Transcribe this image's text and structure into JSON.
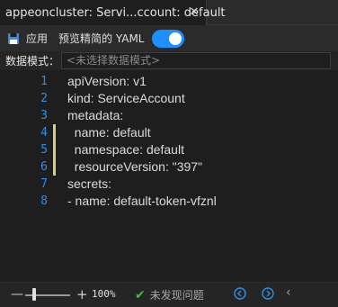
{
  "tab": {
    "title": "appeoncluster: Servi...ccount: default",
    "close_glyph": "✕"
  },
  "toolbar": {
    "apply_label": "应用",
    "apply_icon": "save-icon",
    "preview_label": "预览精简的 YAML",
    "preview_enabled": true,
    "accent": "#1e8fff"
  },
  "mode": {
    "label": "数据模式：",
    "placeholder": "<未选择数据模式>"
  },
  "editor": {
    "lines": [
      {
        "num": "1",
        "text": "apiVersion: v1",
        "changed": false
      },
      {
        "num": "2",
        "text": "kind: ServiceAccount",
        "changed": false
      },
      {
        "num": "3",
        "text": "metadata:",
        "changed": false
      },
      {
        "num": "4",
        "text": "  name: default",
        "changed": true
      },
      {
        "num": "5",
        "text": "  namespace: default",
        "changed": true
      },
      {
        "num": "6",
        "text": "  resourceVersion: \"397\"",
        "changed": true
      },
      {
        "num": "7",
        "text": "secrets:",
        "changed": false
      },
      {
        "num": "8",
        "text": "- name: default-token-vfznl",
        "changed": false
      }
    ],
    "line_number_color": "#2e8fe8",
    "change_marker_color": "#d6d27a"
  },
  "status": {
    "zoom_minus": "—",
    "zoom_plus": "+",
    "zoom_value": "100%",
    "zoom_level": 0.2,
    "issues_label": "未发现问题",
    "check_glyph": "✔",
    "back_glyph": "‹"
  }
}
